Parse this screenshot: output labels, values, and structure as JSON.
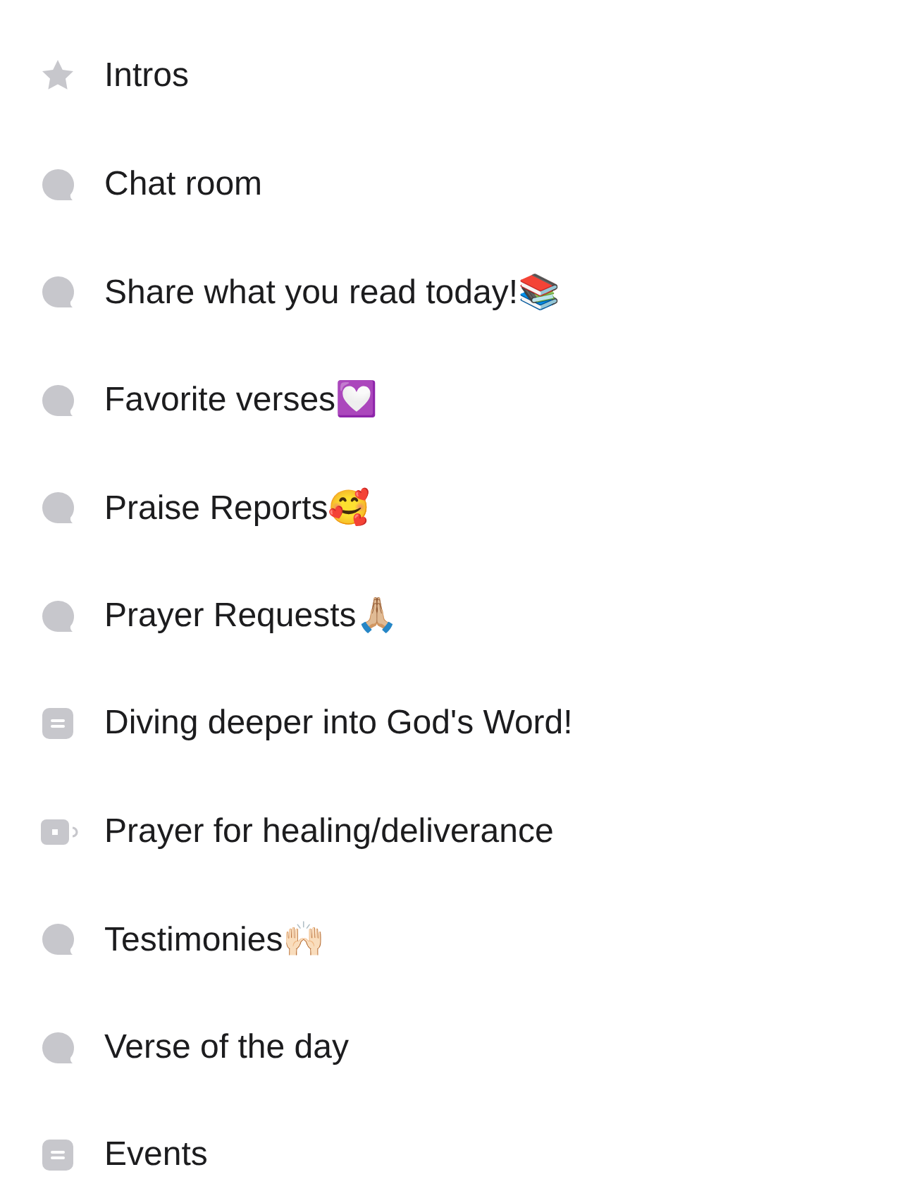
{
  "channels": [
    {
      "name": "Intros",
      "kind": "star"
    },
    {
      "name": "Chat room",
      "kind": "chat"
    },
    {
      "name": "Share what you read today!📚",
      "kind": "chat"
    },
    {
      "name": "Favorite verses💟",
      "kind": "chat"
    },
    {
      "name": "Praise Reports🥰",
      "kind": "chat"
    },
    {
      "name": "Prayer Requests🙏🏼",
      "kind": "chat"
    },
    {
      "name": "Diving deeper into God's Word!",
      "kind": "post"
    },
    {
      "name": "Prayer for healing/deliverance",
      "kind": "voice"
    },
    {
      "name": "Testimonies🙌🏻",
      "kind": "chat"
    },
    {
      "name": "Verse of the day",
      "kind": "chat"
    },
    {
      "name": "Events",
      "kind": "post"
    }
  ]
}
